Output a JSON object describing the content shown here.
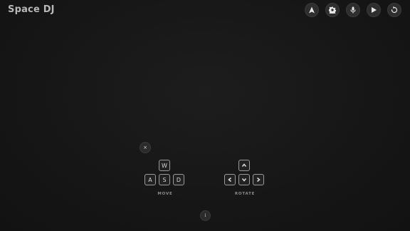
{
  "app": {
    "title": "Space DJ"
  },
  "toolbar": {
    "buttons": [
      {
        "icon": "navigation-arrow-icon"
      },
      {
        "icon": "gear-icon"
      },
      {
        "icon": "microphone-icon"
      },
      {
        "icon": "play-icon"
      },
      {
        "icon": "reset-icon"
      }
    ]
  },
  "controls": {
    "close_glyph": "×",
    "move": {
      "label": "MOVE",
      "keys": [
        "W",
        "A",
        "S",
        "D"
      ]
    },
    "rotate": {
      "label": "ROTATE",
      "keys": [
        "up-arrow-icon",
        "left-arrow-icon",
        "down-arrow-icon",
        "right-arrow-icon"
      ]
    },
    "info_glyph": "i"
  }
}
